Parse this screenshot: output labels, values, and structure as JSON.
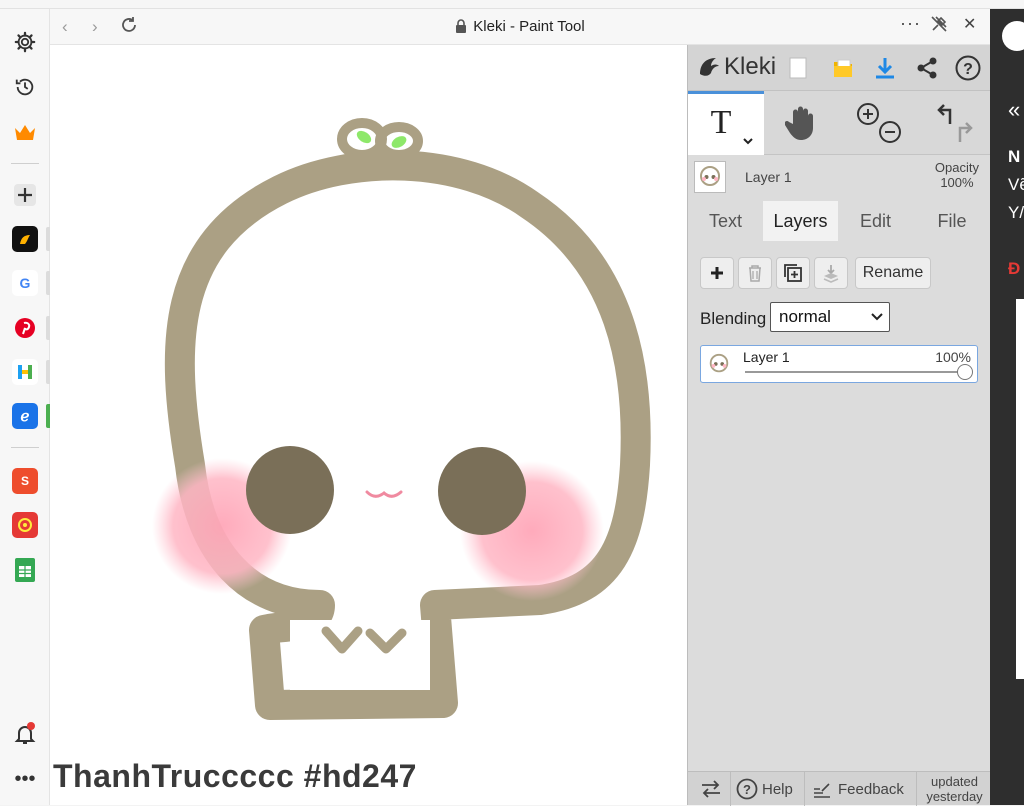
{
  "window": {
    "title": "Kleki - Paint Tool"
  },
  "canvas": {
    "signature": "ThanhTruccccc #hd247"
  },
  "kleki": {
    "logo": "Kleki",
    "current_layer_name": "Layer 1",
    "opacity_label": "Opacity",
    "opacity_value": "100%",
    "tabs": [
      {
        "label": "Text",
        "active": false
      },
      {
        "label": "Layers",
        "active": true
      },
      {
        "label": "Edit",
        "active": false
      },
      {
        "label": "File",
        "active": false
      }
    ],
    "rename_label": "Rename",
    "blending_label": "Blending",
    "blending_value": "normal",
    "layers": [
      {
        "name": "Layer 1",
        "opacity_text": "100%",
        "opacity": 1.0
      }
    ],
    "footer": {
      "help": "Help",
      "feedback": "Feedback",
      "updated_line1": "updated",
      "updated_line2": "yesterday"
    }
  },
  "background_page": {
    "lines": [
      "N",
      "Vẽ",
      "Y/",
      "Đ"
    ]
  },
  "colors": {
    "accent": "#4a90d9",
    "download": "#1e88e5",
    "folder": "#f0b400",
    "head_outline": "#aba084",
    "eye": "#7a6f58",
    "blush": "#ffa6b8",
    "sprout": "#8ee86a"
  }
}
